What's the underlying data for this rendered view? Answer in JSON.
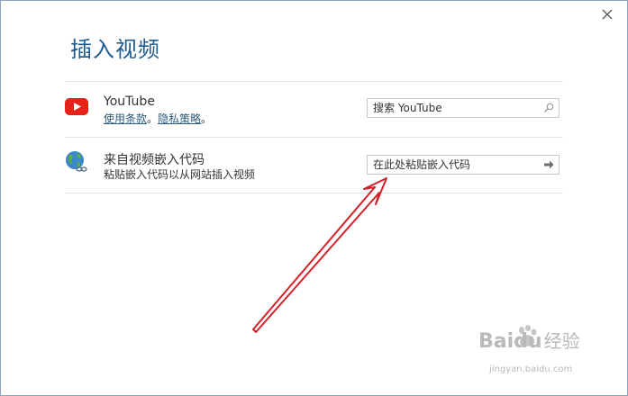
{
  "dialog": {
    "title": "插入视频"
  },
  "youtube": {
    "name": "YouTube",
    "terms_link": "使用条款",
    "separator": "。",
    "privacy_link": "隐私策略",
    "end_mark": "。",
    "search_placeholder": "搜索 YouTube"
  },
  "embed": {
    "title": "来自视频嵌入代码",
    "subtitle": "粘贴嵌入代码以从网站插入视频",
    "input_placeholder": "在此处粘贴嵌入代码"
  },
  "watermark": {
    "brand": "Baidu",
    "brand_suffix": "经验",
    "url": "jingyan.baidu.com"
  },
  "colors": {
    "title": "#1d5a8e",
    "youtube_red": "#e62117",
    "arrow_annotation": "#d42026",
    "link": "#2c5a7a"
  }
}
